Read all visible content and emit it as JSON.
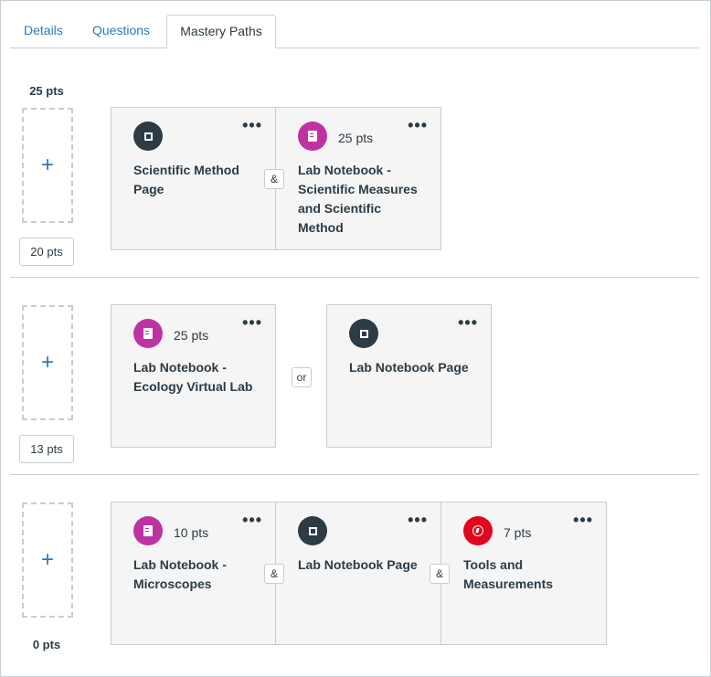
{
  "tabs": [
    {
      "label": "Details"
    },
    {
      "label": "Questions"
    },
    {
      "label": "Mastery Paths"
    }
  ],
  "ranges": [
    {
      "top_label": "25 pts",
      "bottom_label": "20 pts",
      "add_symbol": "+",
      "items": [
        {
          "title": "Scientific Method Page",
          "icon": "page-icon",
          "pts": "",
          "menu": "•••"
        },
        {
          "title": "Lab Notebook - Scientific Measures and Scientific Method",
          "icon": "notebook-icon",
          "pts": "25 pts",
          "menu": "•••"
        }
      ],
      "connectors": [
        "&"
      ]
    },
    {
      "bottom_label": "13 pts",
      "add_symbol": "+",
      "items": [
        {
          "title": "Lab Notebook - Ecology Virtual Lab",
          "icon": "notebook-icon",
          "pts": "25 pts",
          "menu": "•••"
        },
        {
          "title": "Lab Notebook Page",
          "icon": "page-icon",
          "pts": "",
          "menu": "•••"
        }
      ],
      "connectors": [
        "or"
      ]
    },
    {
      "bottom_label": "0 pts",
      "add_symbol": "+",
      "items": [
        {
          "title": "Lab Notebook - Microscopes",
          "icon": "notebook-icon",
          "pts": "10 pts",
          "menu": "•••"
        },
        {
          "title": "Lab Notebook Page",
          "icon": "page-icon",
          "pts": "",
          "menu": "•••"
        },
        {
          "title": "Tools and Measurements",
          "icon": "quiz-icon",
          "pts": "7 pts",
          "menu": "•••"
        }
      ],
      "connectors": [
        "&",
        "&"
      ]
    }
  ],
  "colors": {
    "link": "#2a7abc",
    "page": "#2d3b45",
    "notebook": "#bf32a4",
    "quiz": "#e0061f",
    "card_bg": "#f5f5f5",
    "border": "#c7cdd1"
  }
}
